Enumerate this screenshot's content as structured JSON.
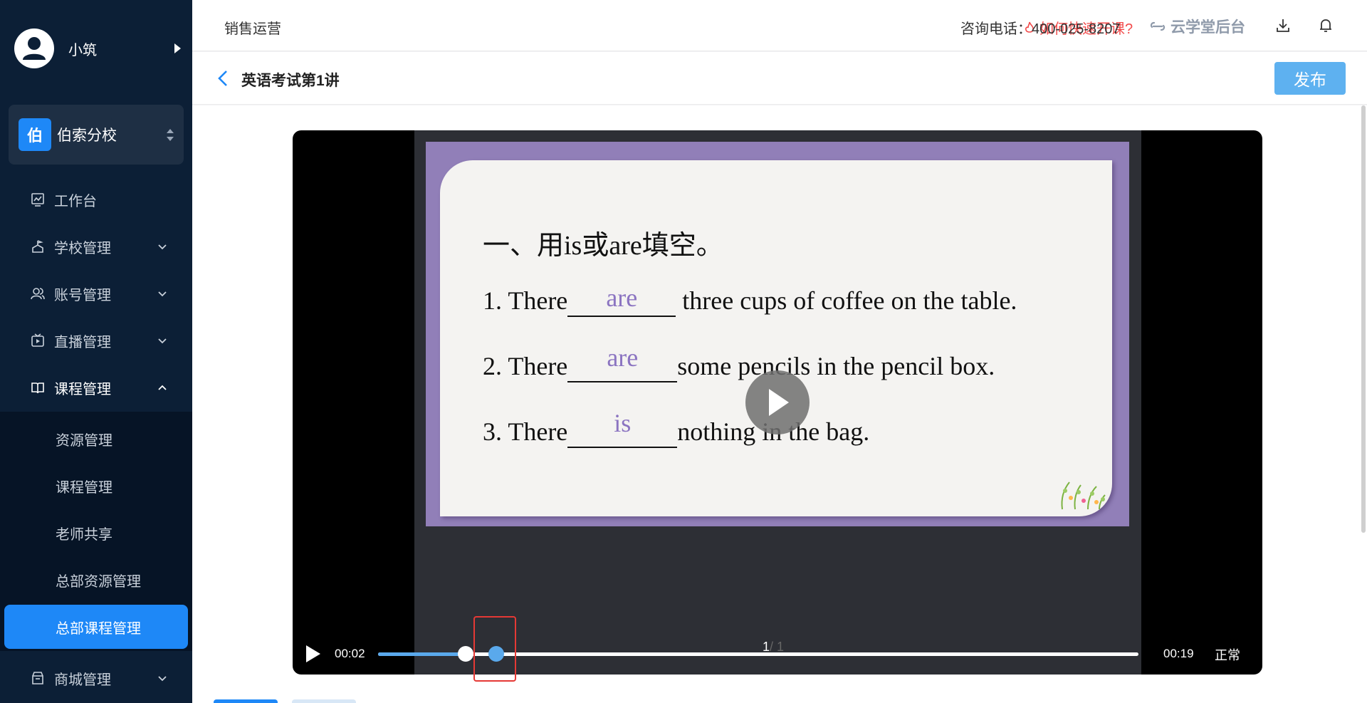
{
  "user": {
    "name": "小筑"
  },
  "school": {
    "badge": "伯",
    "name": "伯索分校"
  },
  "nav": [
    {
      "label": "工作台",
      "icon": "dashboard-icon"
    },
    {
      "label": "学校管理",
      "icon": "school-icon"
    },
    {
      "label": "账号管理",
      "icon": "account-icon"
    },
    {
      "label": "直播管理",
      "icon": "live-icon"
    },
    {
      "label": "课程管理",
      "icon": "course-icon"
    },
    {
      "label": "商城管理",
      "icon": "shop-icon"
    }
  ],
  "submenu": [
    {
      "label": "资源管理"
    },
    {
      "label": "课程管理"
    },
    {
      "label": "老师共享"
    },
    {
      "label": "总部资源管理"
    },
    {
      "label": "总部课程管理"
    }
  ],
  "topbar": {
    "section": "销售运营",
    "quick_link": "如何快速开课?",
    "phone": "咨询电话：400-025-8207",
    "brand": "云学堂后台"
  },
  "header": {
    "title": "英语考试第1讲",
    "publish": "发布"
  },
  "slide": {
    "heading": "一、用is或are填空。",
    "lines": [
      {
        "prefix": "1. There",
        "answer": "are",
        "suffix": " three cups of coffee on the table."
      },
      {
        "prefix": "2. There",
        "answer": "are",
        "suffix": "some pencils in the pencil box."
      },
      {
        "prefix": "3. There",
        "answer": "is",
        "suffix": "nothing in the bag."
      }
    ]
  },
  "player": {
    "current_time": "00:02",
    "total_time": "00:19",
    "speed": "正常",
    "page_current": "1",
    "page_sep_total": "/ 1",
    "progress": 0.115,
    "marker_progress": 0.155
  },
  "colors": {
    "sidebar_bg": "#0c1f36",
    "accent": "#1e88f7",
    "publish_button": "#5eb1f0",
    "slide_frame": "#917fb8",
    "answer_text": "#8b74c1",
    "progress_fill": "#5aa9ec",
    "highlight_box": "#e53935",
    "quick_link": "#f24b4b"
  }
}
